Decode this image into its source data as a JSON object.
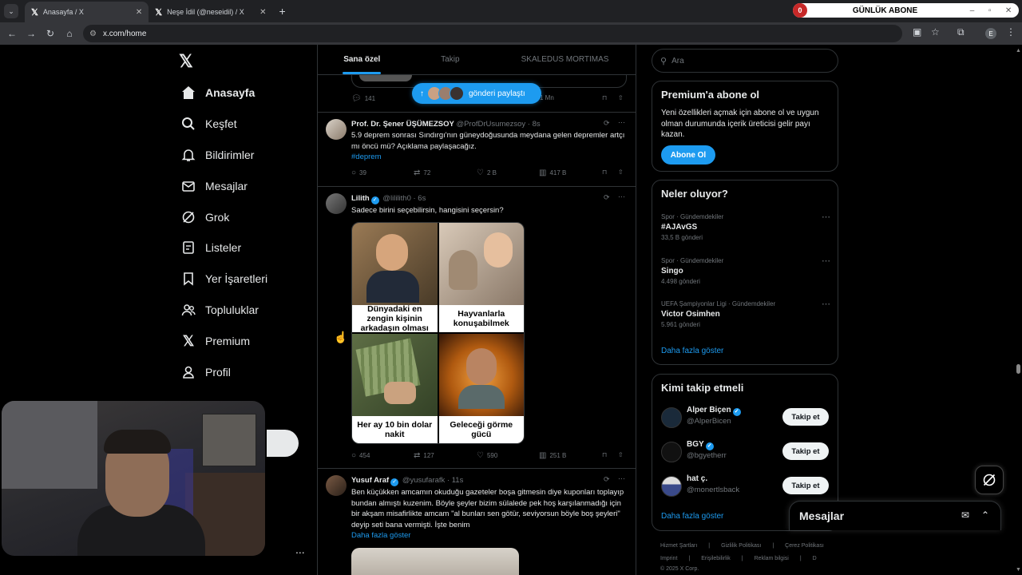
{
  "browser": {
    "tabs": [
      {
        "title": "Anasayfa / X",
        "active": true
      },
      {
        "title": "Neşe İdil (@neseidil) / X",
        "active": false
      }
    ],
    "url": "x.com/home",
    "new_tab": "+",
    "extension": {
      "count": "0",
      "title": "GÜNLÜK ABONE"
    },
    "profile_initial": "E"
  },
  "nav": {
    "items": [
      {
        "label": "Anasayfa",
        "icon": "home-icon"
      },
      {
        "label": "Keşfet",
        "icon": "search-icon"
      },
      {
        "label": "Bildirimler",
        "icon": "bell-icon"
      },
      {
        "label": "Mesajlar",
        "icon": "envelope-icon"
      },
      {
        "label": "Grok",
        "icon": "grok-icon"
      },
      {
        "label": "Listeler",
        "icon": "list-icon"
      },
      {
        "label": "Yer İşaretleri",
        "icon": "bookmark-icon"
      },
      {
        "label": "Topluluklar",
        "icon": "people-icon"
      },
      {
        "label": "Premium",
        "icon": "x-logo-icon"
      },
      {
        "label": "Profil",
        "icon": "person-icon"
      }
    ],
    "more": "..."
  },
  "main_tabs": [
    "Sana özel",
    "Takip",
    "SKALEDUS MORTIMAS"
  ],
  "pill": {
    "label": "gönderi paylaştı"
  },
  "prev_post": {
    "replies": "141",
    "views": "1 Mn"
  },
  "tweets": [
    {
      "name": "Prof. Dr. Şener ÜŞÜMEZSOY",
      "handle": "@ProfDrUsumezsoy · 8s",
      "text": "5.9 deprem sonrası Sındırgı'nın güneydoğusunda meydana gelen depremler artçı mı öncü mü? Açıklama paylaşacağız.",
      "hashtag": "#deprem",
      "replies": "39",
      "retweets": "72",
      "likes": "2 B",
      "views": "417 B"
    },
    {
      "name": "Lilith",
      "handle": "@lililith0 · 6s",
      "text": "Sadece birini seçebilirsin, hangisini seçersin?",
      "captions": [
        "Dünyadaki en zengin kişinin arkadaşın olması",
        "Hayvanlarla konuşabilmek",
        "Her ay 10 bin dolar nakit",
        "Geleceği görme gücü"
      ],
      "replies": "454",
      "retweets": "127",
      "likes": "590",
      "views": "251 B"
    },
    {
      "name": "Yusuf Araf",
      "handle": "@yusufarafk · 11s",
      "text": "Ben küçükken amcamın okuduğu gazeteler boşa gitmesin diye kuponları toplayıp bundan almıştı kuzenim. Böyle şeyler bizim sülalede pek hoş karşılanmadığı için bir akşam misafirlikte amcam \"al bunları sen götür, seviyorsun böyle boş şeyleri\" deyip seti bana vermişti. İşte benim",
      "show_more": "Daha fazla göster"
    }
  ],
  "right": {
    "search_placeholder": "Ara",
    "premium": {
      "title": "Premium'a abone ol",
      "text": "Yeni özellikleri açmak için abone ol ve uygun olman durumunda içerik üreticisi gelir payı kazan.",
      "button": "Abone Ol"
    },
    "trends": {
      "title": "Neler oluyor?",
      "items": [
        {
          "category": "Spor · Gündemdekiler",
          "name": "#AJAvGS",
          "count": "33,5 B gönderi"
        },
        {
          "category": "Spor · Gündemdekiler",
          "name": "Singo",
          "count": "4.498 gönderi"
        },
        {
          "category": "UEFA Şampiyonlar Ligi · Gündemdekiler",
          "name": "Victor Osimhen",
          "count": "5.961 gönderi"
        }
      ],
      "more": "Daha fazla göster"
    },
    "who_to_follow": {
      "title": "Kimi takip etmeli",
      "items": [
        {
          "name": "Alper Biçen",
          "handle": "@AlperBicen",
          "verified": true
        },
        {
          "name": "BGY",
          "handle": "@bgyetherr",
          "verified": true
        },
        {
          "name": "hat ç.",
          "handle": "@monertlsback",
          "verified": false
        }
      ],
      "follow_label": "Takip et",
      "more": "Daha fazla göster"
    },
    "footer": {
      "line1": [
        "Hizmet Şartları",
        "|",
        "Gizlilik Politikası",
        "|",
        "Çerez Politikası"
      ],
      "line2": [
        "Imprint",
        "|",
        "Erişilebilirlik",
        "|",
        "Reklam bilgisi",
        "|",
        "D"
      ],
      "line3": "© 2025 X Corp."
    }
  },
  "messages_drawer": {
    "title": "Mesajlar"
  }
}
